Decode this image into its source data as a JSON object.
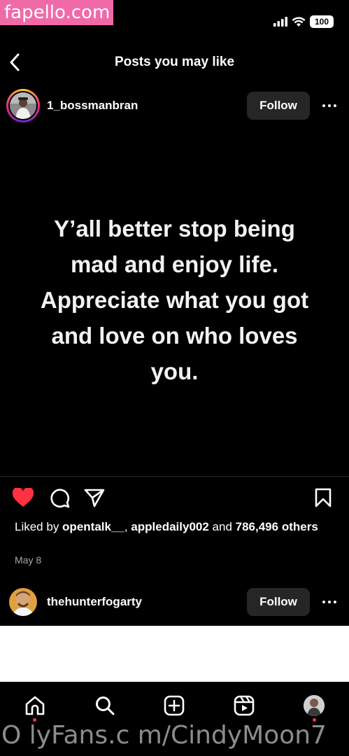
{
  "watermark_top": "fapello.com",
  "status": {
    "time": "",
    "battery": "100"
  },
  "header": {
    "title": "Posts you may like"
  },
  "post1": {
    "username": "1_bossmanbran",
    "follow_label": "Follow",
    "text": "Y’all better stop being mad and enjoy life. Appreciate what you got and love on who loves you.",
    "liked_by_prefix": "Liked by ",
    "liked_user1": "opentalk__",
    "liked_sep": ", ",
    "liked_user2": "appledaily002",
    "liked_and": " and ",
    "liked_count": "786,496 others",
    "date": "May 8",
    "liked": true
  },
  "post2": {
    "username": "thehunterfogarty",
    "follow_label": "Follow"
  },
  "icons": {
    "back": "chevron-left-icon",
    "more": "more-horizontal-icon",
    "like": "heart-icon",
    "comment": "comment-icon",
    "share": "send-icon",
    "save": "bookmark-icon",
    "nav": [
      "home-icon",
      "search-icon",
      "create-icon",
      "reels-icon",
      "profile-avatar"
    ]
  },
  "colors": {
    "like": "#ff3040",
    "follow_bg": "#262626",
    "watermark": "#f06aa8"
  },
  "watermark_bottom": "O lyFans.c m/CindyMoon7"
}
